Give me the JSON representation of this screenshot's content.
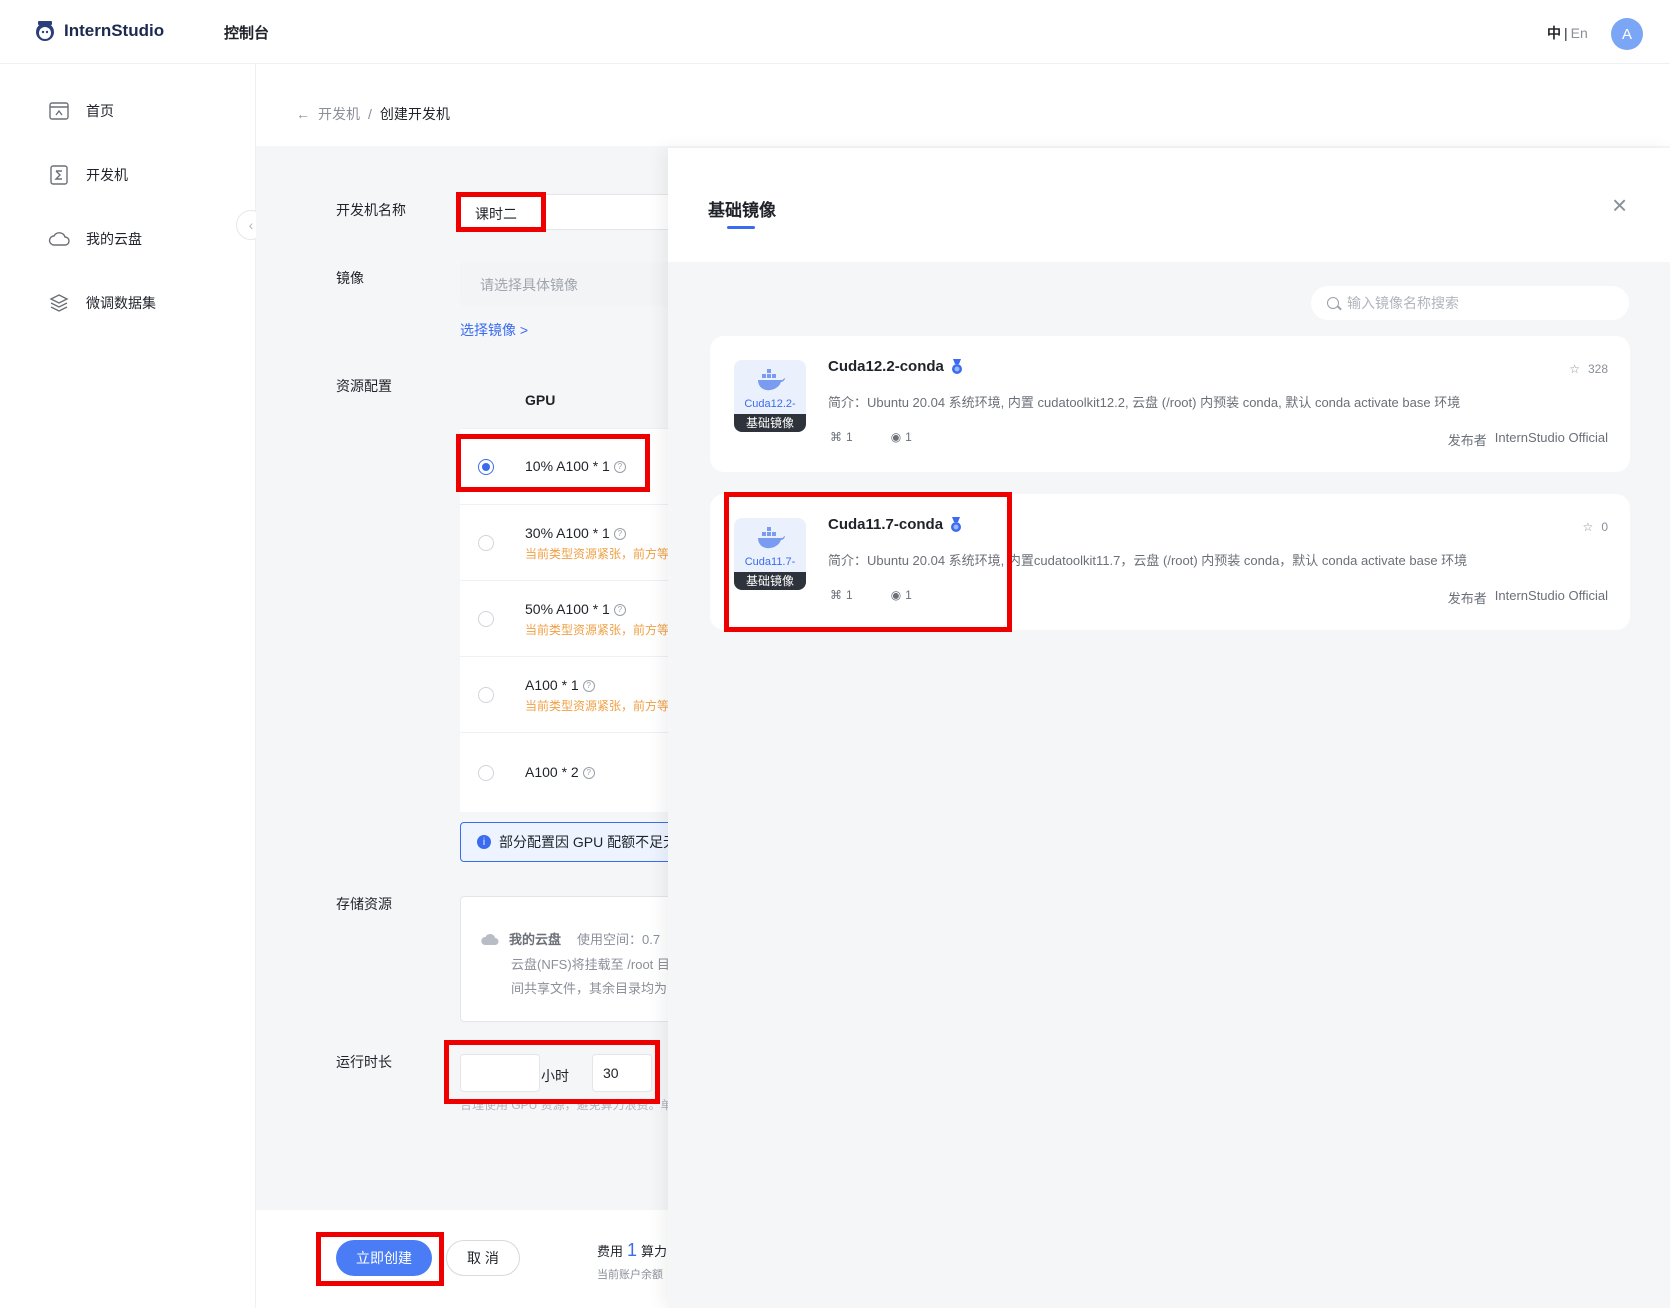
{
  "header": {
    "brand": "InternStudio",
    "console": "控制台",
    "lang_active": "中",
    "lang_sep": "|",
    "lang_other": "En",
    "avatar": "A"
  },
  "sidebar": {
    "items": [
      {
        "label": "首页",
        "icon": "home-icon"
      },
      {
        "label": "开发机",
        "icon": "terminal-icon"
      },
      {
        "label": "我的云盘",
        "icon": "cloud-icon"
      },
      {
        "label": "微调数据集",
        "icon": "layers-icon"
      }
    ]
  },
  "breadcrumb": {
    "back": "←",
    "parent": "开发机",
    "sep": "/",
    "current": "创建开发机"
  },
  "form": {
    "name_label": "开发机名称",
    "name_value": "课时二",
    "image_label": "镜像",
    "image_placeholder": "请选择具体镜像",
    "choose_image": "选择镜像 >",
    "resource_label": "资源配置",
    "gpu_header": "GPU",
    "gpu_options": [
      {
        "label": "10% A100 * 1",
        "warn": "",
        "selected": true
      },
      {
        "label": "30% A100 * 1",
        "warn": "当前类型资源紧张，前方等",
        "selected": false
      },
      {
        "label": "50% A100 * 1",
        "warn": "当前类型资源紧张，前方等",
        "selected": false
      },
      {
        "label": "A100 * 1",
        "warn": "当前类型资源紧张，前方等",
        "selected": false
      },
      {
        "label": "A100 * 2",
        "warn": "",
        "selected": false
      }
    ],
    "gpu_notice": "部分配置因 GPU 配额不足无",
    "storage_label": "存储资源",
    "storage_title": "我的云盘",
    "storage_usage": "使用空间：0.7",
    "storage_desc1": "云盘(NFS)将挂载至 /root 目",
    "storage_desc2": "间共享文件，其余目录均为",
    "runtime_label": "运行时长",
    "hours_value": "",
    "hours_unit": "小时",
    "minutes_value": "30",
    "runtime_hint": "合理使用 GPU 资源，避免算力浪费。单"
  },
  "footer": {
    "create": "立即创建",
    "cancel": "取 消",
    "fee_label": "费用",
    "fee_value": "1",
    "fee_unit": "算力",
    "balance": "当前账户余额"
  },
  "drawer": {
    "title": "基础镜像",
    "close": "×",
    "search_placeholder": "输入镜像名称搜索",
    "cards": [
      {
        "name": "Cuda12.2-conda",
        "thumb_name": "Cuda12.2-",
        "thumb_tag": "基础镜像",
        "desc": "简介：Ubuntu 20.04 系统环境, 内置 cudatoolkit12.2, 云盘 (/root) 内预装 conda, 默认 conda activate base 环境",
        "forks": "1",
        "views": "1",
        "stars": "328",
        "publisher_label": "发布者",
        "publisher": "InternStudio Official"
      },
      {
        "name": "Cuda11.7-conda",
        "thumb_name": "Cuda11.7-",
        "thumb_tag": "基础镜像",
        "desc": "简介：Ubuntu 20.04 系统环境, 内置cudatoolkit11.7，云盘 (/root) 内预装 conda，默认 conda activate base 环境",
        "forks": "1",
        "views": "1",
        "stars": "0",
        "publisher_label": "发布者",
        "publisher": "InternStudio Official"
      }
    ]
  },
  "colors": {
    "accent": "#3b6cf0",
    "warning": "#f0a045",
    "highlight": "#ee0000"
  }
}
